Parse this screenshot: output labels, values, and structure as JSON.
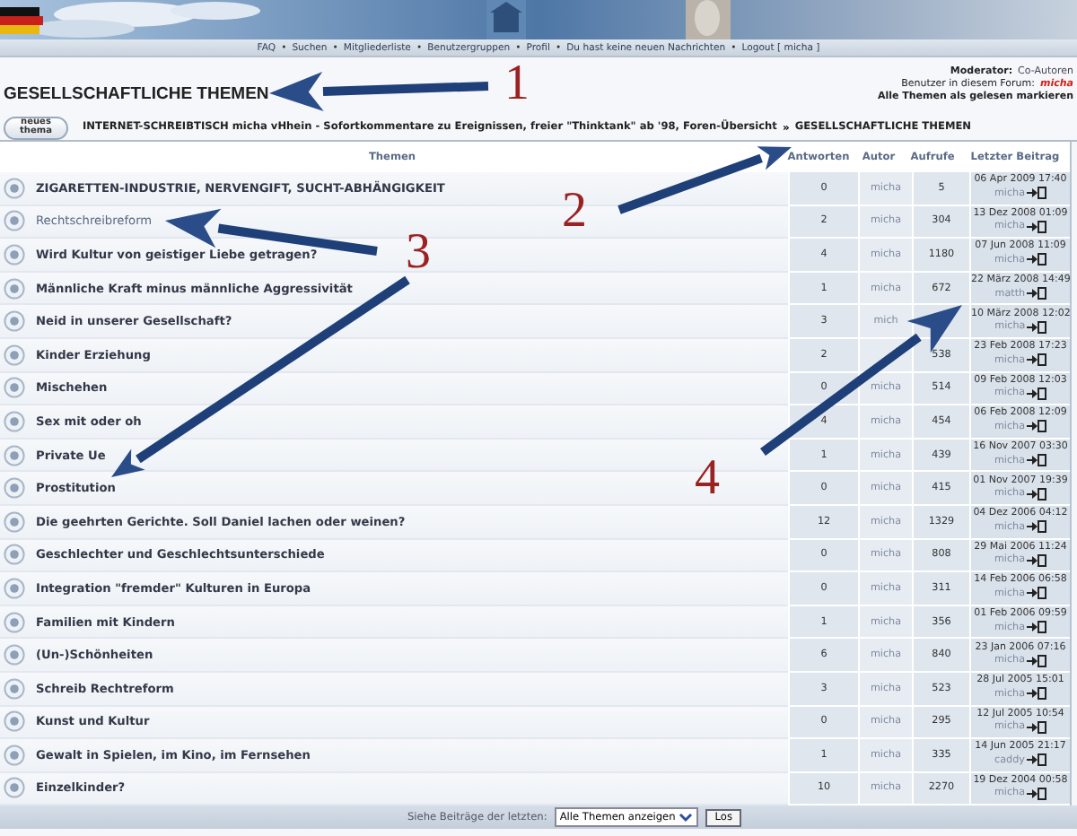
{
  "nav_links": [
    {
      "label": "FAQ"
    },
    {
      "label": "Suchen"
    },
    {
      "label": "Mitgliederliste"
    },
    {
      "label": "Benutzergruppen"
    },
    {
      "label": "Profil"
    },
    {
      "label": "Du hast keine neuen Nachrichten"
    },
    {
      "label": "Logout [ micha ]"
    }
  ],
  "nav_separator": "•",
  "forum": {
    "title": "GESELLSCHAFTLICHE THEMEN",
    "moderator_label": "Moderator:",
    "moderator": "Co-Autoren",
    "users_label": "Benutzer in diesem Forum:",
    "user": "micha",
    "mark_read": "Alle Themen als gelesen markieren"
  },
  "new_topic_button": "neues thema",
  "breadcrumb": {
    "items": [
      "INTERNET-SCHREIBTISCH micha vHhein - Sofortkommentare zu Ereignissen, freier \"Thinktank\" ab '98, Foren-Übersicht",
      "GESELLSCHAFTLICHE THEMEN"
    ],
    "separator": "»"
  },
  "columns": [
    "Themen",
    "Antworten",
    "Autor",
    "Aufrufe",
    "Letzter Beitrag"
  ],
  "rows": [
    {
      "title": "ZIGARETTEN-INDUSTRIE, NERVENGIFT, SUCHT-ABHÄNGIGKEIT",
      "visited": false,
      "replies": "0",
      "author": "micha",
      "views": "5",
      "last_date": "06 Apr 2009 17:40",
      "last_author": "micha"
    },
    {
      "title": "Rechtschreibreform",
      "visited": true,
      "replies": "2",
      "author": "micha",
      "views": "304",
      "last_date": "13 Dez 2008 01:09",
      "last_author": "micha"
    },
    {
      "title": "Wird Kultur von geistiger Liebe getragen?",
      "visited": false,
      "replies": "4",
      "author": "micha",
      "views": "1180",
      "last_date": "07 Jun 2008 11:09",
      "last_author": "micha"
    },
    {
      "title": "Männliche Kraft minus männliche Aggressivität",
      "visited": false,
      "replies": "1",
      "author": "micha",
      "views": "672",
      "last_date": "22 März 2008 14:49",
      "last_author": "matth"
    },
    {
      "title": "Neid in unserer Gesellschaft?",
      "visited": false,
      "replies": "3",
      "author": "mich",
      "last_date": "10 März 2008 12:02",
      "last_author": "micha"
    },
    {
      "title": "Kinder Erziehung",
      "visited": false,
      "replies": "2",
      "views": "538",
      "last_date": "23 Feb 2008 17:23",
      "last_author": "micha"
    },
    {
      "title": "Mischehen",
      "visited": false,
      "replies": "0",
      "author": "micha",
      "views": "514",
      "last_date": "09 Feb 2008 12:03",
      "last_author": "micha"
    },
    {
      "title": "Sex mit oder oh",
      "visited": false,
      "replies": "4",
      "author": "micha",
      "views": "454",
      "last_date": "06 Feb 2008 12:09",
      "last_author": "micha"
    },
    {
      "title": "Private Ue",
      "visited": false,
      "replies": "1",
      "author": "micha",
      "views": "439",
      "last_date": "16 Nov 2007 03:30",
      "last_author": "micha"
    },
    {
      "title": "Prostitution",
      "visited": false,
      "replies": "0",
      "author": "micha",
      "views": "415",
      "last_date": "01 Nov 2007 19:39",
      "last_author": "micha"
    },
    {
      "title": "Die geehrten Gerichte. Soll Daniel lachen oder weinen?",
      "visited": false,
      "replies": "12",
      "author": "micha",
      "views": "1329",
      "last_date": "04 Dez 2006 04:12",
      "last_author": "micha"
    },
    {
      "title": "Geschlechter und Geschlechtsunterschiede",
      "visited": false,
      "replies": "0",
      "author": "micha",
      "views": "808",
      "last_date": "29 Mai 2006 11:24",
      "last_author": "micha"
    },
    {
      "title": "Integration \"fremder\" Kulturen in Europa",
      "visited": false,
      "replies": "0",
      "author": "micha",
      "views": "311",
      "last_date": "14 Feb 2006 06:58",
      "last_author": "micha"
    },
    {
      "title": "Familien mit Kindern",
      "visited": false,
      "replies": "1",
      "author": "micha",
      "views": "356",
      "last_date": "01 Feb 2006 09:59",
      "last_author": "micha"
    },
    {
      "title": "(Un-)Schönheiten",
      "visited": false,
      "replies": "6",
      "author": "micha",
      "views": "840",
      "last_date": "23 Jan 2006 07:16",
      "last_author": "micha"
    },
    {
      "title": "Schreib Rechtreform",
      "visited": false,
      "replies": "3",
      "author": "micha",
      "views": "523",
      "last_date": "28 Jul 2005 15:01",
      "last_author": "micha"
    },
    {
      "title": "Kunst und Kultur",
      "visited": false,
      "replies": "0",
      "author": "micha",
      "views": "295",
      "last_date": "12 Jul 2005 10:54",
      "last_author": "micha"
    },
    {
      "title": "Gewalt in Spielen, im Kino, im Fernsehen",
      "visited": false,
      "replies": "1",
      "author": "micha",
      "views": "335",
      "last_date": "14 Jun 2005 21:17",
      "last_author": "caddy"
    },
    {
      "title": "Einzelkinder?",
      "visited": false,
      "replies": "10",
      "author": "micha",
      "views": "2270",
      "last_date": "19 Dez 2004 00:58",
      "last_author": "micha"
    }
  ],
  "footer": {
    "label": "Siehe Beiträge der letzten:",
    "select_value": "Alle Themen anzeigen",
    "go_button": "Los"
  },
  "annotations": [
    {
      "label": "1"
    },
    {
      "label": "2"
    },
    {
      "label": "3"
    },
    {
      "label": "4"
    }
  ]
}
